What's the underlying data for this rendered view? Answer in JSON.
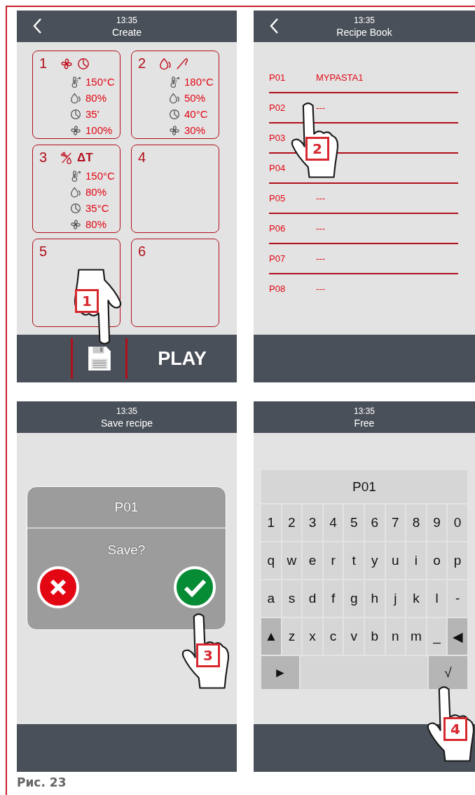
{
  "caption": "Рис. 23",
  "screens": [
    {
      "kind": "create",
      "time": "13:35",
      "title": "Create",
      "back_button": true,
      "pointer": "1",
      "play": "PLAY",
      "cards": [
        {
          "number": "1",
          "modes": [
            {
              "kind": "fan"
            },
            {
              "kind": "clock"
            }
          ],
          "params": [
            {
              "kind": "temperature",
              "value": "150°C"
            },
            {
              "kind": "humidity",
              "value": "80%"
            },
            {
              "kind": "time",
              "value": "35'"
            },
            {
              "kind": "fan",
              "value": "100%"
            }
          ]
        },
        {
          "number": "2",
          "modes": [
            {
              "kind": "drop"
            },
            {
              "kind": "probe"
            }
          ],
          "params": [
            {
              "kind": "temperature",
              "value": "180°C"
            },
            {
              "kind": "humidity",
              "value": "50%"
            },
            {
              "kind": "time",
              "value": "40°C"
            },
            {
              "kind": "fan",
              "value": "30%"
            }
          ]
        },
        {
          "number": "3",
          "modes": [
            {
              "kind": "fan_humidity"
            },
            {
              "kind": "delta_t",
              "label": "ΔT"
            }
          ],
          "params": [
            {
              "kind": "temperature",
              "value": "150°C"
            },
            {
              "kind": "humidity",
              "value": "80%"
            },
            {
              "kind": "time",
              "value": "35°C"
            },
            {
              "kind": "fan",
              "value": "80%"
            }
          ]
        },
        {
          "number": "4"
        },
        {
          "number": "5"
        },
        {
          "number": "6"
        }
      ]
    },
    {
      "kind": "recipe_book",
      "time": "13:35",
      "title": "Recipe Book",
      "back_button": true,
      "pointer": "2",
      "recipes": [
        {
          "code": "P01",
          "name": "MYPASTA1"
        },
        {
          "code": "P02",
          "name": "---"
        },
        {
          "code": "P03"
        },
        {
          "code": "P04"
        },
        {
          "code": "P05",
          "name": "---"
        },
        {
          "code": "P06",
          "name": "---"
        },
        {
          "code": "P07",
          "name": "---"
        },
        {
          "code": "P08",
          "name": "---"
        }
      ]
    },
    {
      "kind": "save_dialog",
      "time": "13:35",
      "title": "Save recipe",
      "back_button": false,
      "pointer": "3",
      "dialog": {
        "recipe": "P01",
        "question": "Save?"
      }
    },
    {
      "kind": "keyboard",
      "time": "13:35",
      "title": "Free",
      "back_button": false,
      "pointer": "4",
      "value": "P01",
      "rows": [
        [
          {
            "label": "1",
            "function": false
          },
          {
            "label": "2",
            "function": false
          },
          {
            "label": "3",
            "function": false
          },
          {
            "label": "4",
            "function": false
          },
          {
            "label": "5",
            "function": false
          },
          {
            "label": "6",
            "function": false
          },
          {
            "label": "7",
            "function": false
          },
          {
            "label": "8",
            "function": false
          },
          {
            "label": "9",
            "function": false
          },
          {
            "label": "0",
            "function": false
          }
        ],
        [
          {
            "label": "q",
            "function": false
          },
          {
            "label": "w",
            "function": false
          },
          {
            "label": "e",
            "function": false
          },
          {
            "label": "r",
            "function": false
          },
          {
            "label": "t",
            "function": false
          },
          {
            "label": "y",
            "function": false
          },
          {
            "label": "u",
            "function": false
          },
          {
            "label": "i",
            "function": false
          },
          {
            "label": "o",
            "function": false
          },
          {
            "label": "p",
            "function": false
          }
        ],
        [
          {
            "label": "a",
            "function": false
          },
          {
            "label": "s",
            "function": false
          },
          {
            "label": "d",
            "function": false
          },
          {
            "label": "f",
            "function": false
          },
          {
            "label": "g",
            "function": false
          },
          {
            "label": "h",
            "function": false
          },
          {
            "label": "j",
            "function": false
          },
          {
            "label": "k",
            "function": false
          },
          {
            "label": "l",
            "function": false
          },
          {
            "label": "-",
            "function": false
          }
        ],
        [
          {
            "label": "▲",
            "function": true
          },
          {
            "label": "z",
            "function": false
          },
          {
            "label": "x",
            "function": false
          },
          {
            "label": "c",
            "function": false
          },
          {
            "label": "v",
            "function": false
          },
          {
            "label": "b",
            "function": false
          },
          {
            "label": "n",
            "function": false
          },
          {
            "label": "m",
            "function": false
          },
          {
            "label": "_",
            "function": false
          },
          {
            "label": "◀",
            "function": true
          }
        ]
      ],
      "bottom_row": {
        "left": "►",
        "right": "√"
      }
    }
  ]
}
